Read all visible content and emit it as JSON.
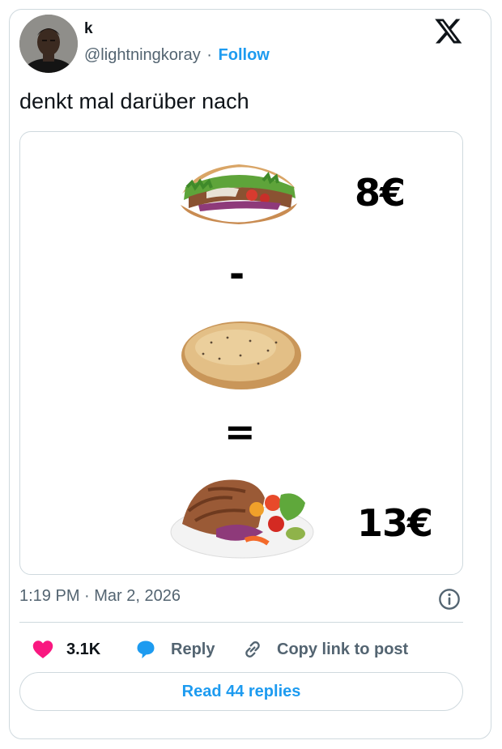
{
  "author": {
    "display_name": "k",
    "handle": "@lightningkoray",
    "separator": "·",
    "follow_label": "Follow"
  },
  "tweet": {
    "text": "denkt mal darüber nach",
    "timestamp": "1:19 PM · Mar 2, 2026"
  },
  "media": {
    "top_price": "8€",
    "minus_sign": "-",
    "equals_sign": "=",
    "bottom_price": "13€",
    "items": [
      "doner-kebab-image",
      "flatbread-image",
      "doner-plate-image"
    ]
  },
  "actions": {
    "like_count": "3.1K",
    "reply_label": "Reply",
    "copy_label": "Copy link to post",
    "read_replies_label": "Read 44 replies"
  },
  "colors": {
    "accent": "#1d9bf0",
    "like": "#f91880",
    "text_secondary": "#536471",
    "border": "#cfd9de"
  }
}
